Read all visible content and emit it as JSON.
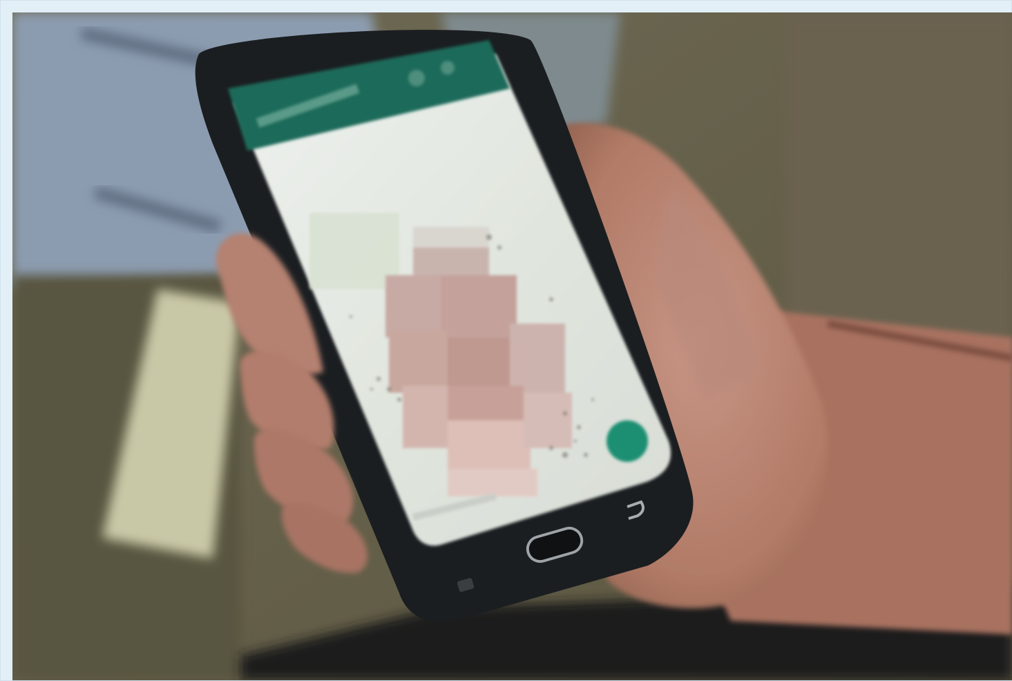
{
  "image": {
    "description_free": true,
    "frame_color": "#e3eff7",
    "palette": {
      "sleeve": "#8f9fb3",
      "background_olive": "#6e6750",
      "floor": "#4e4a3d",
      "skin": "#b98572",
      "skin_shadow": "#8a5c4c",
      "phone_body": "#1c1f22",
      "app_header": "#1f6b5a",
      "screen": "#e7ebe6",
      "fab": "#1f8f72",
      "pixelated": "#c9a9a0"
    }
  }
}
